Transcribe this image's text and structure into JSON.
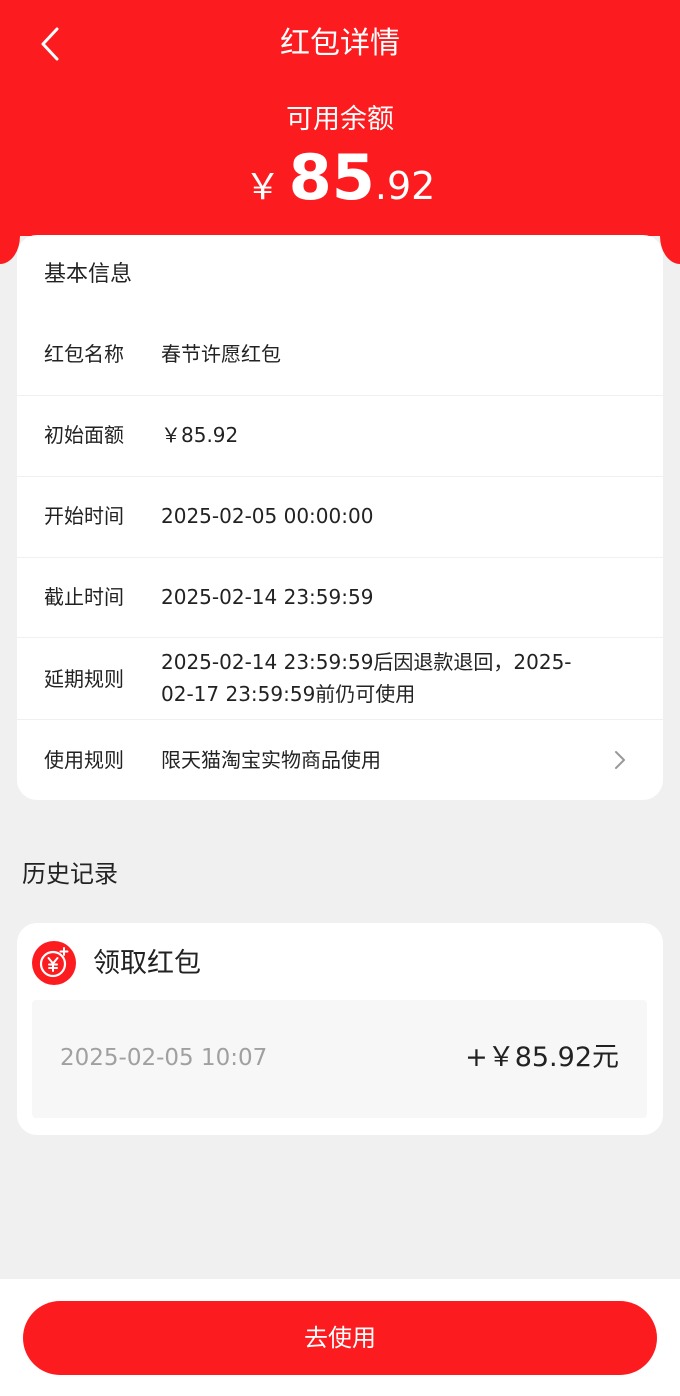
{
  "header": {
    "title": "红包详情",
    "balance_label": "可用余额",
    "balance_currency": "￥",
    "balance_integer": "85",
    "balance_decimal": ".92",
    "back_icon": "chevron-left-icon",
    "bg_color": "#fc1c1f"
  },
  "info": {
    "section_title": "基本信息",
    "rows": [
      {
        "label": "红包名称",
        "value": "春节许愿红包"
      },
      {
        "label": "初始面额",
        "value": "￥85.92"
      },
      {
        "label": "开始时间",
        "value": "2025-02-05 00:00:00"
      },
      {
        "label": "截止时间",
        "value": "2025-02-14 23:59:59"
      },
      {
        "label": "延期规则",
        "value_line1": "2025-02-14 23:59:59后因退款退回，2025-",
        "value_line2": "02-17 23:59:59前仍可使用"
      },
      {
        "label": "使用规则",
        "value": "限天猫淘宝实物商品使用",
        "icon": "chevron-right-icon"
      }
    ]
  },
  "history": {
    "title": "历史记录",
    "type_label": "领取红包",
    "type_icon": "yuan-coin-icon",
    "entries": [
      {
        "date": "2025-02-05 10:07",
        "amount": "+￥85.92元"
      }
    ]
  },
  "footer": {
    "button_label": "去使用"
  }
}
